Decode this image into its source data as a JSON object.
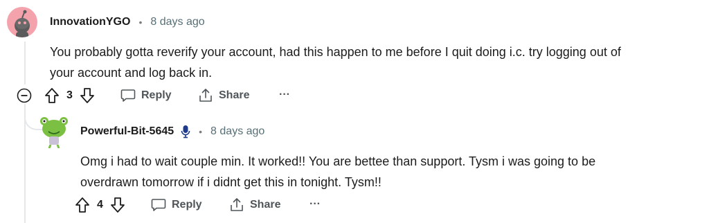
{
  "comments": [
    {
      "author": "InnovationYGO",
      "separator": "•",
      "time": "8 days ago",
      "text_line1": "You probably gotta reverify your account, had this happen to me before I quit doing i.c. try logging out of",
      "text_line2": "your account and log back in.",
      "score": "3",
      "reply_label": "Reply",
      "share_label": "Share",
      "more_label": "···",
      "avatar_icon": "reddit-snoo-avatar-icon",
      "avatar_color": "#f4a3ad"
    },
    {
      "author": "Powerful-Bit-5645",
      "separator": "•",
      "time": "8 days ago",
      "text_line1": "Omg i had to wait couple min. It worked!! You are bettee than support. Tysm i was going to be",
      "text_line2": "overdrawn tomorrow if i didnt get this in tonight. Tysm!!",
      "score": "4",
      "reply_label": "Reply",
      "share_label": "Share",
      "more_label": "···",
      "avatar_icon": "green-snoo-avatar-icon",
      "badge_icon": "microphone-icon",
      "badge_color": "#1e3a8a"
    }
  ],
  "colors": {
    "thread_line": "#e5e8ea",
    "text": "#1c1c1c",
    "meta": "#576f76"
  }
}
